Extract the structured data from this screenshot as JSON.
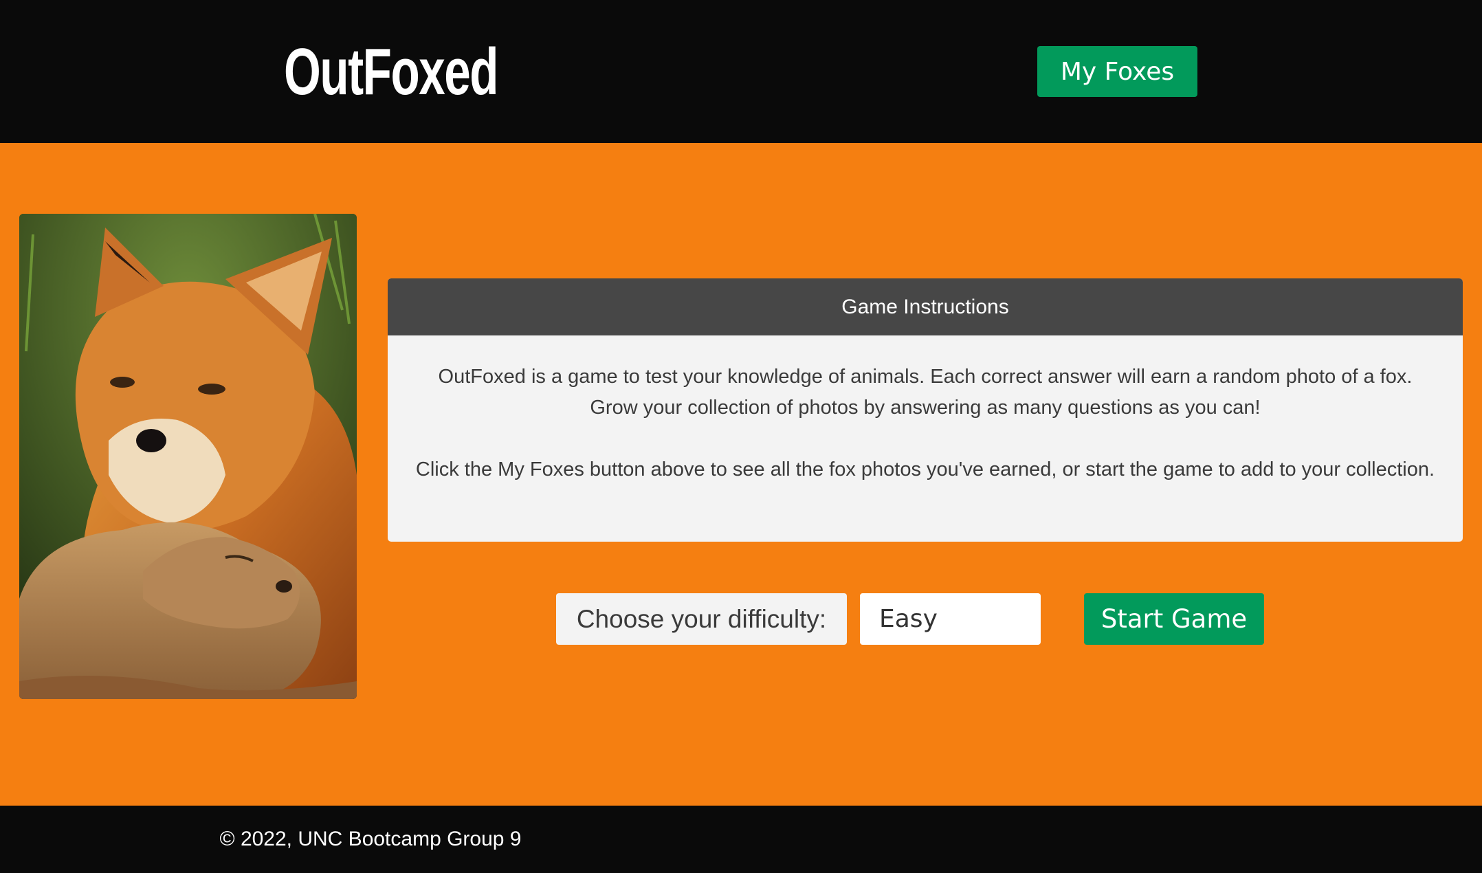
{
  "header": {
    "brand": "OutFoxed",
    "my_foxes_label": "My Foxes"
  },
  "hero_image": {
    "alt": "Adult red fox with fox kit"
  },
  "instructions": {
    "title": "Game Instructions",
    "paragraph1": "OutFoxed is a game to test your knowledge of animals. Each correct answer will earn a random photo of a fox. Grow your collection of photos by answering as many questions as you can!",
    "paragraph2": "Click the My Foxes button above to see all the fox photos you've earned, or start the game to add to your collection."
  },
  "controls": {
    "difficulty_label": "Choose your difficulty:",
    "difficulty_value": "Easy",
    "start_label": "Start Game"
  },
  "footer": {
    "copyright": "© 2022, UNC Bootcamp Group 9"
  },
  "colors": {
    "header_bg": "#0a0a0a",
    "page_bg": "#f57f11",
    "button_green": "#029a5b",
    "card_header": "#474747",
    "card_body": "#f3f3f3"
  }
}
